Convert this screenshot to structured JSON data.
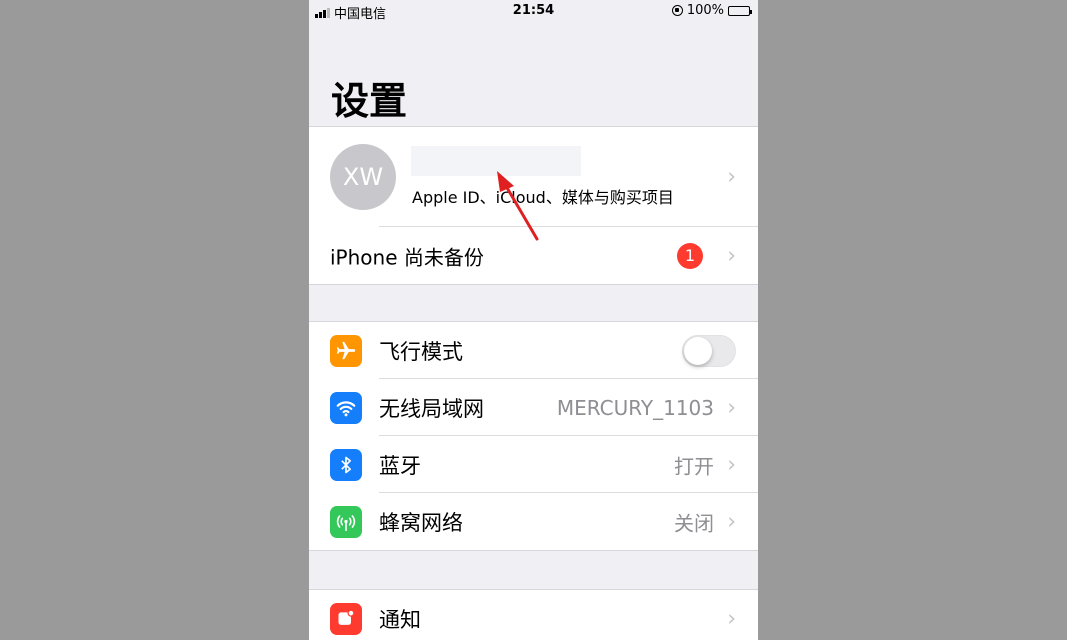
{
  "status_bar": {
    "carrier": "中国电信",
    "time": "21:54",
    "battery": "100%"
  },
  "title": "设置",
  "profile": {
    "initials": "XW",
    "subtitle": "Apple ID、iCloud、媒体与购买项目"
  },
  "backup": {
    "label": "iPhone 尚未备份",
    "badge": "1"
  },
  "connectivity": [
    {
      "label": "飞行模式",
      "value": "",
      "icon": "airplane-icon",
      "color": "#ff9500",
      "toggle_on": false
    },
    {
      "label": "无线局域网",
      "value": "MERCURY_1103",
      "icon": "wifi-icon",
      "color": "#147efb"
    },
    {
      "label": "蓝牙",
      "value": "打开",
      "icon": "bluetooth-icon",
      "color": "#147efb"
    },
    {
      "label": "蜂窝网络",
      "value": "关闭",
      "icon": "cellular-icon",
      "color": "#34c759"
    }
  ],
  "notifications": {
    "label": "通知",
    "icon": "notification-icon",
    "color": "#ff3b30"
  },
  "annotation_color": "#e02020"
}
